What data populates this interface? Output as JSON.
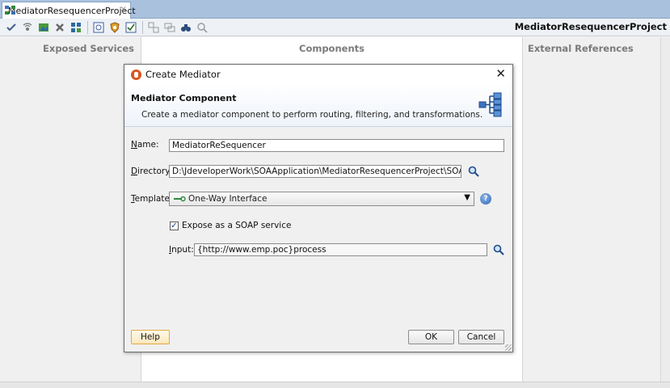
{
  "tab": {
    "label": "MediatorResequencerProject",
    "close": "×"
  },
  "toolbar": {
    "title": "MediatorResequencerProject",
    "icons": [
      "validate-icon",
      "wire-icon",
      "image-icon",
      "delete-icon",
      "deploy-icon",
      "test-icon",
      "shield-icon",
      "checklist-icon",
      "layout-icon",
      "group-icon",
      "search-binoculars-icon",
      "zoom-icon"
    ]
  },
  "canvas": {
    "lanes": {
      "left": "Exposed Services",
      "middle": "Components",
      "right": "External References"
    }
  },
  "dialog": {
    "title": "Create Mediator",
    "close": "✕",
    "header_title": "Mediator Component",
    "header_subtitle": "Create a mediator component to perform routing, filtering, and transformations.",
    "name": {
      "label_first": "N",
      "label_rest": "ame:",
      "value": "MediatorReSequencer"
    },
    "directory": {
      "label_first": "D",
      "label_rest": "irectory:",
      "value": "D:\\JdeveloperWork\\SOAApplication\\MediatorResequencerProject\\SOA\\Mediators"
    },
    "template": {
      "label_first": "T",
      "label_rest": "emplate:",
      "value": "One-Way Interface"
    },
    "expose_soap": {
      "label": "Expose as a SOAP service",
      "checked": true
    },
    "input": {
      "label_first": "I",
      "label_rest": "nput:",
      "value": "{http://www.emp.poc}process"
    },
    "buttons": {
      "help": "Help",
      "ok": "OK",
      "cancel": "Cancel"
    },
    "accent_color": "#e2a840"
  }
}
